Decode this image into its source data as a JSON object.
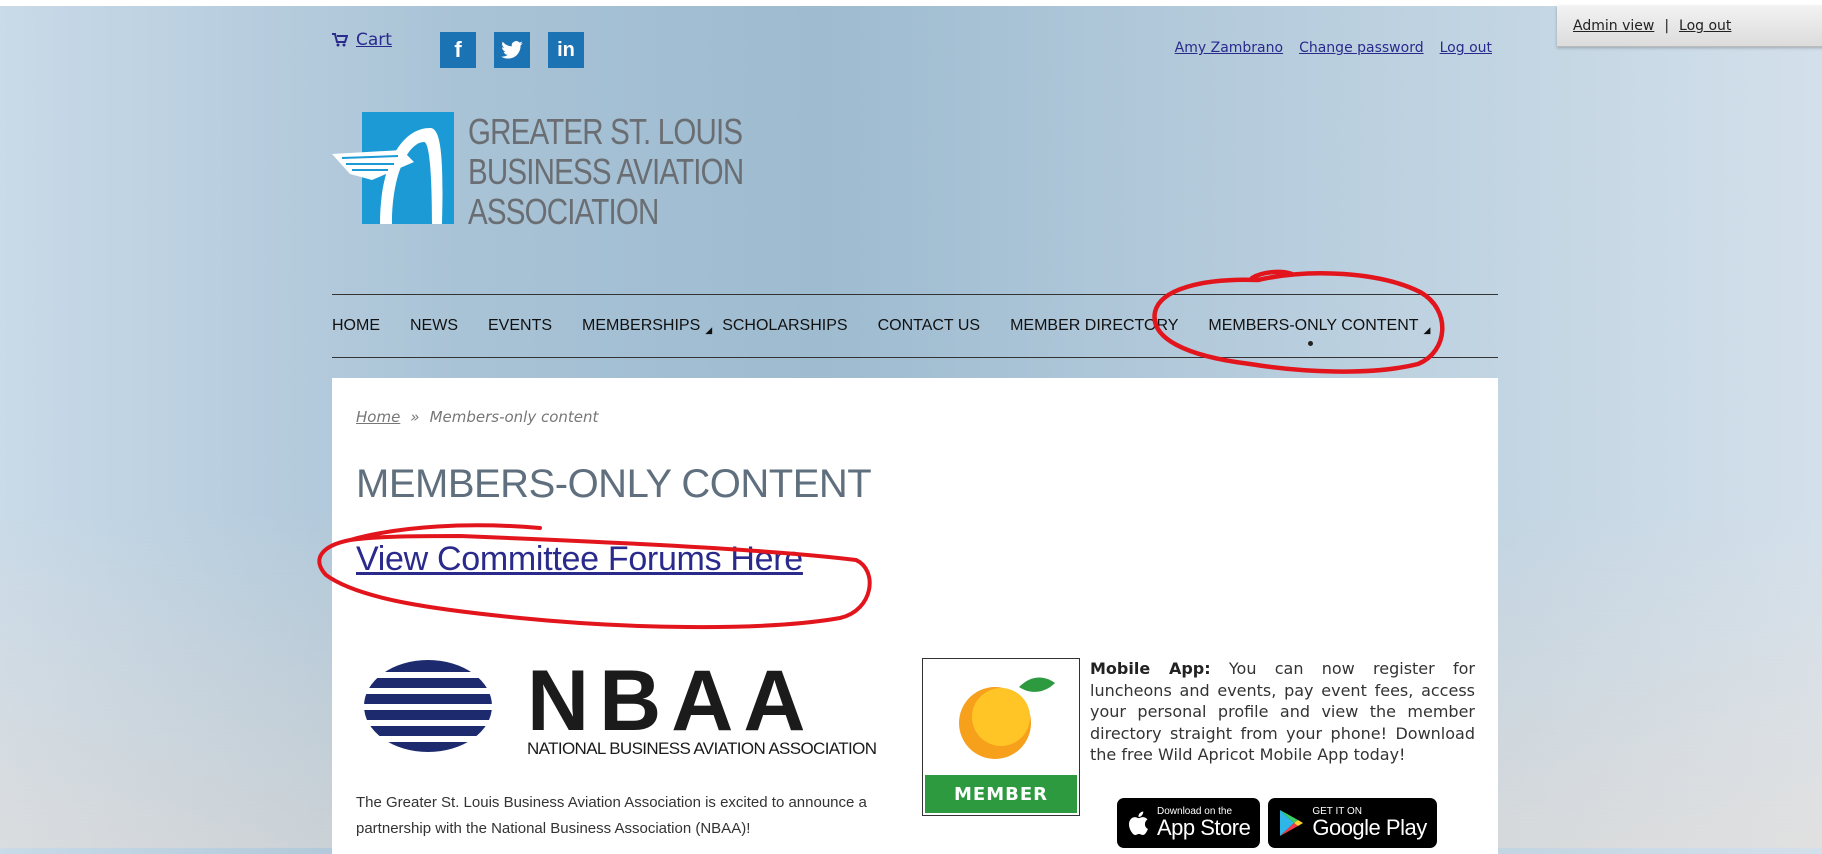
{
  "header": {
    "cart_label": "Cart",
    "social": [
      "f",
      "t",
      "in"
    ],
    "user_name": "Amy Zambrano",
    "change_password": "Change password",
    "logout": "Log out",
    "logo_lines": [
      "GREATER ST. LOUIS",
      "BUSINESS AVIATION",
      "ASSOCIATION"
    ]
  },
  "nav": {
    "items": [
      "HOME",
      "NEWS",
      "EVENTS",
      "MEMBERSHIPS",
      "SCHOLARSHIPS",
      "CONTACT US",
      "MEMBER DIRECTORY",
      "MEMBERS-ONLY CONTENT"
    ],
    "dropdown_marker": "◢"
  },
  "breadcrumb": {
    "home": "Home",
    "sep": "»",
    "current": "Members-only content"
  },
  "main": {
    "title": "MEMBERS-ONLY CONTENT",
    "forum_link": "View Committee Forums Here",
    "nbaa_title": "NBAA",
    "nbaa_subtitle": "NATIONAL BUSINESS AVIATION ASSOCIATION",
    "nbaa_text": "The Greater St. Louis Business Aviation Association is excited to announce a partnership with the National Business Association (NBAA)!",
    "member_badge": "MEMBER",
    "mobile_label": "Mobile App:",
    "mobile_text": " You can now register for luncheons and events, pay event fees, access your personal profile and view the member directory straight from your phone! Download the free Wild Apricot Mobile App today!",
    "appstore_small": "Download on the",
    "appstore_big": "App Store",
    "googleplay_small": "GET IT ON",
    "googleplay_big": "Google Play"
  },
  "admin": {
    "admin_view": "Admin view",
    "sep": "|",
    "logout": "Log out"
  },
  "colors": {
    "link": "#2a2a8c",
    "brand_blue": "#1b9ad6",
    "social_blue": "#1b73b4",
    "annotation_red": "#e3151c",
    "member_green": "#2e9a40"
  }
}
